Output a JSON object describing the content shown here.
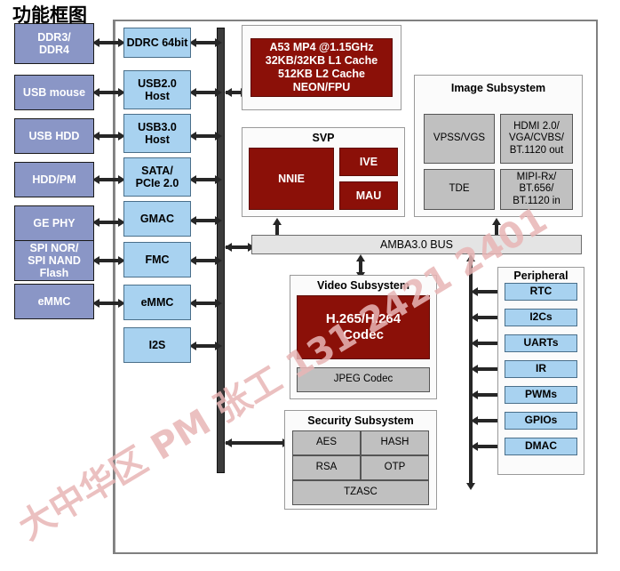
{
  "title": "功能框图",
  "watermark": "大中华区 PM 张工 131 2421 2401",
  "colors": {
    "external_block": "#8a96c6",
    "interface_block": "#a8d2f0",
    "red_block": "#8b1008",
    "grey_block": "#c0c0c0",
    "bus_bar": "#3b3b3b",
    "amba_bus": "#e4e4e4",
    "frame": "#808080",
    "watermark": "#e8b6b6"
  },
  "external_devices": [
    {
      "label": "DDR3/\nDDR4"
    },
    {
      "label": "USB mouse"
    },
    {
      "label": "USB HDD"
    },
    {
      "label": "HDD/PM"
    },
    {
      "label": "GE PHY"
    },
    {
      "label": "SPI NOR/\nSPI NAND\nFlash"
    },
    {
      "label": "eMMC"
    }
  ],
  "interfaces": [
    {
      "label": "DDRC 64bit"
    },
    {
      "label": "USB2.0\nHost"
    },
    {
      "label": "USB3.0\nHost"
    },
    {
      "label": "SATA/\nPCIe 2.0"
    },
    {
      "label": "GMAC"
    },
    {
      "label": "FMC"
    },
    {
      "label": "eMMC"
    },
    {
      "label": "I2S"
    }
  ],
  "cpu": {
    "label": "A53 MP4 @1.15GHz\n32KB/32KB L1 Cache\n512KB L2 Cache\nNEON/FPU"
  },
  "svp": {
    "title": "SVP",
    "blocks": [
      {
        "label": "NNIE"
      },
      {
        "label": "IVE"
      },
      {
        "label": "MAU"
      }
    ]
  },
  "image_subsystem": {
    "title": "Image Subsystem",
    "blocks": [
      {
        "label": "VPSS/VGS"
      },
      {
        "label": "HDMI 2.0/\nVGA/CVBS/\nBT.1120 out"
      },
      {
        "label": "TDE"
      },
      {
        "label": "MIPI-Rx/\nBT.656/\nBT.1120 in"
      }
    ]
  },
  "amba_bus": {
    "label": "AMBA3.0 BUS"
  },
  "video_subsystem": {
    "title": "Video Subsystem",
    "codec": {
      "label": "H.265/H.264\nCodec"
    },
    "jpeg": {
      "label": "JPEG Codec"
    }
  },
  "security_subsystem": {
    "title": "Security Subsystem",
    "blocks": [
      {
        "label": "AES"
      },
      {
        "label": "HASH"
      },
      {
        "label": "RSA"
      },
      {
        "label": "OTP"
      },
      {
        "label": "TZASC"
      }
    ]
  },
  "peripheral": {
    "title": "Peripheral",
    "blocks": [
      {
        "label": "RTC"
      },
      {
        "label": "I2Cs"
      },
      {
        "label": "UARTs"
      },
      {
        "label": "IR"
      },
      {
        "label": "PWMs"
      },
      {
        "label": "GPIOs"
      },
      {
        "label": "DMAC"
      }
    ]
  }
}
